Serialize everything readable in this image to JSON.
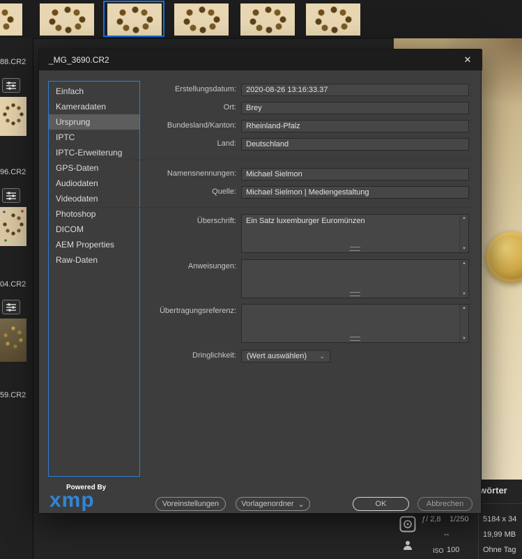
{
  "icons": {
    "close": "✕",
    "chevron_down": "⌄",
    "scroll_up": "▲",
    "scroll_down": "▼"
  },
  "filmstrip": {
    "items": [
      {
        "filename": "88.CR2"
      },
      {
        "filename": "96.CR2"
      },
      {
        "filename": "04.CR2"
      },
      {
        "filename": "59.CR2"
      }
    ]
  },
  "dialog": {
    "title": "_MG_3690.CR2",
    "nav": {
      "selected": "Ursprung",
      "items": [
        "Einfach",
        "Kameradaten",
        "Ursprung",
        "IPTC",
        "IPTC-Erweiterung",
        "GPS-Daten",
        "Audiodaten",
        "Videodaten",
        "Photoshop",
        "DICOM",
        "AEM Properties",
        "Raw-Daten"
      ]
    },
    "fields": {
      "creation_date": {
        "label": "Erstellungsdatum:",
        "value": "2020-08-26 13:16:33.37"
      },
      "location": {
        "label": "Ort:",
        "value": "Brey"
      },
      "state": {
        "label": "Bundesland/Kanton:",
        "value": "Rheinland-Pfalz"
      },
      "country": {
        "label": "Land:",
        "value": "Deutschland"
      },
      "credit": {
        "label": "Namensnennungen:",
        "value": "Michael Sielmon"
      },
      "source": {
        "label": "Quelle:",
        "value": "Michael Sielmon | Mediengestaltung"
      },
      "headline": {
        "label": "Überschrift:",
        "value": "Ein Satz luxemburger Euromünzen"
      },
      "instructions": {
        "label": "Anweisungen:",
        "value": ""
      },
      "transmission": {
        "label": "Übertragungsreferenz:",
        "value": ""
      },
      "urgency": {
        "label": "Dringlichkeit:",
        "value": "(Wert auswählen)"
      }
    },
    "footer": {
      "powered_by": "Powered By",
      "logo": "xmp",
      "presets": "Voreinstellungen",
      "templates": "Vorlagenordner",
      "ok": "OK",
      "cancel": "Abbrechen"
    }
  },
  "metadata_panel": {
    "keywords_header": "wörter",
    "aperture": "ƒ/ 2,8",
    "shutter": "1/250",
    "dimensions": "5184 x 34",
    "exposure_dash": "--",
    "filesize": "19,99 MB",
    "iso_label": "ISO",
    "iso_value": "100",
    "tags": "Ohne Tag"
  }
}
